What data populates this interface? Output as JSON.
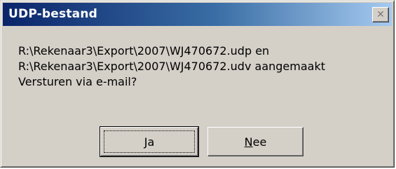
{
  "dialog": {
    "title": "UDP-bestand",
    "close_symbol": "✕",
    "message_lines": [
      "R:\\Rekenaar3\\Export\\2007\\WJ470672.udp en",
      "R:\\Rekenaar3\\Export\\2007\\WJ470672.udv aangemaakt",
      "Versturen via e-mail?"
    ],
    "buttons": {
      "yes": {
        "accel": "J",
        "rest": "a"
      },
      "no": {
        "accel": "N",
        "rest": "ee"
      }
    }
  },
  "colors": {
    "titlebar_start": "#0a246a",
    "titlebar_end": "#a6caf0",
    "face": "#d4d0c8"
  },
  "icons": [
    "close-icon"
  ]
}
